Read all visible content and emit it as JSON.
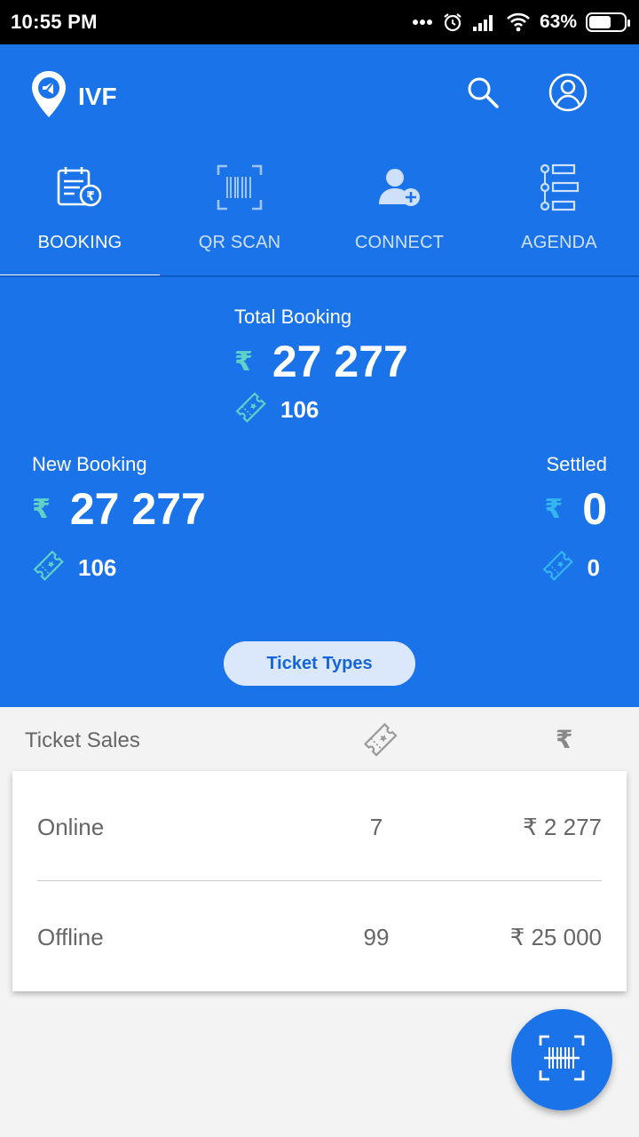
{
  "status_bar": {
    "time": "10:55 PM",
    "battery": "63%",
    "battery_level": 0.63
  },
  "app": {
    "title": "IVF"
  },
  "colors": {
    "primary": "#1a73e8",
    "rupee_accent": "#5ed2c6",
    "settled_accent": "#33b5ef",
    "button_bg": "#dbe8fb"
  },
  "tabs": [
    {
      "label": "BOOKING",
      "icon": "booking-receipt-icon",
      "active": true
    },
    {
      "label": "QR SCAN",
      "icon": "barcode-scan-icon",
      "active": false
    },
    {
      "label": "CONNECT",
      "icon": "add-user-icon",
      "active": false
    },
    {
      "label": "AGENDA",
      "icon": "agenda-list-icon",
      "active": false
    }
  ],
  "summary": {
    "total": {
      "label": "Total Booking",
      "currency": "₹",
      "amount": "27 277",
      "tickets": "106"
    },
    "new": {
      "label": "New Booking",
      "currency": "₹",
      "amount": "27 277",
      "tickets": "106"
    },
    "settled": {
      "label": "Settled",
      "currency": "₹",
      "amount": "0",
      "tickets": "0"
    },
    "ticket_types_button": "Ticket Types"
  },
  "ticket_sales": {
    "label": "Ticket Sales",
    "currency_header": "₹",
    "rows": [
      {
        "name": "Online",
        "count": "7",
        "amount": "₹ 2 277"
      },
      {
        "name": "Offline",
        "count": "99",
        "amount": "₹ 25 000"
      }
    ]
  }
}
